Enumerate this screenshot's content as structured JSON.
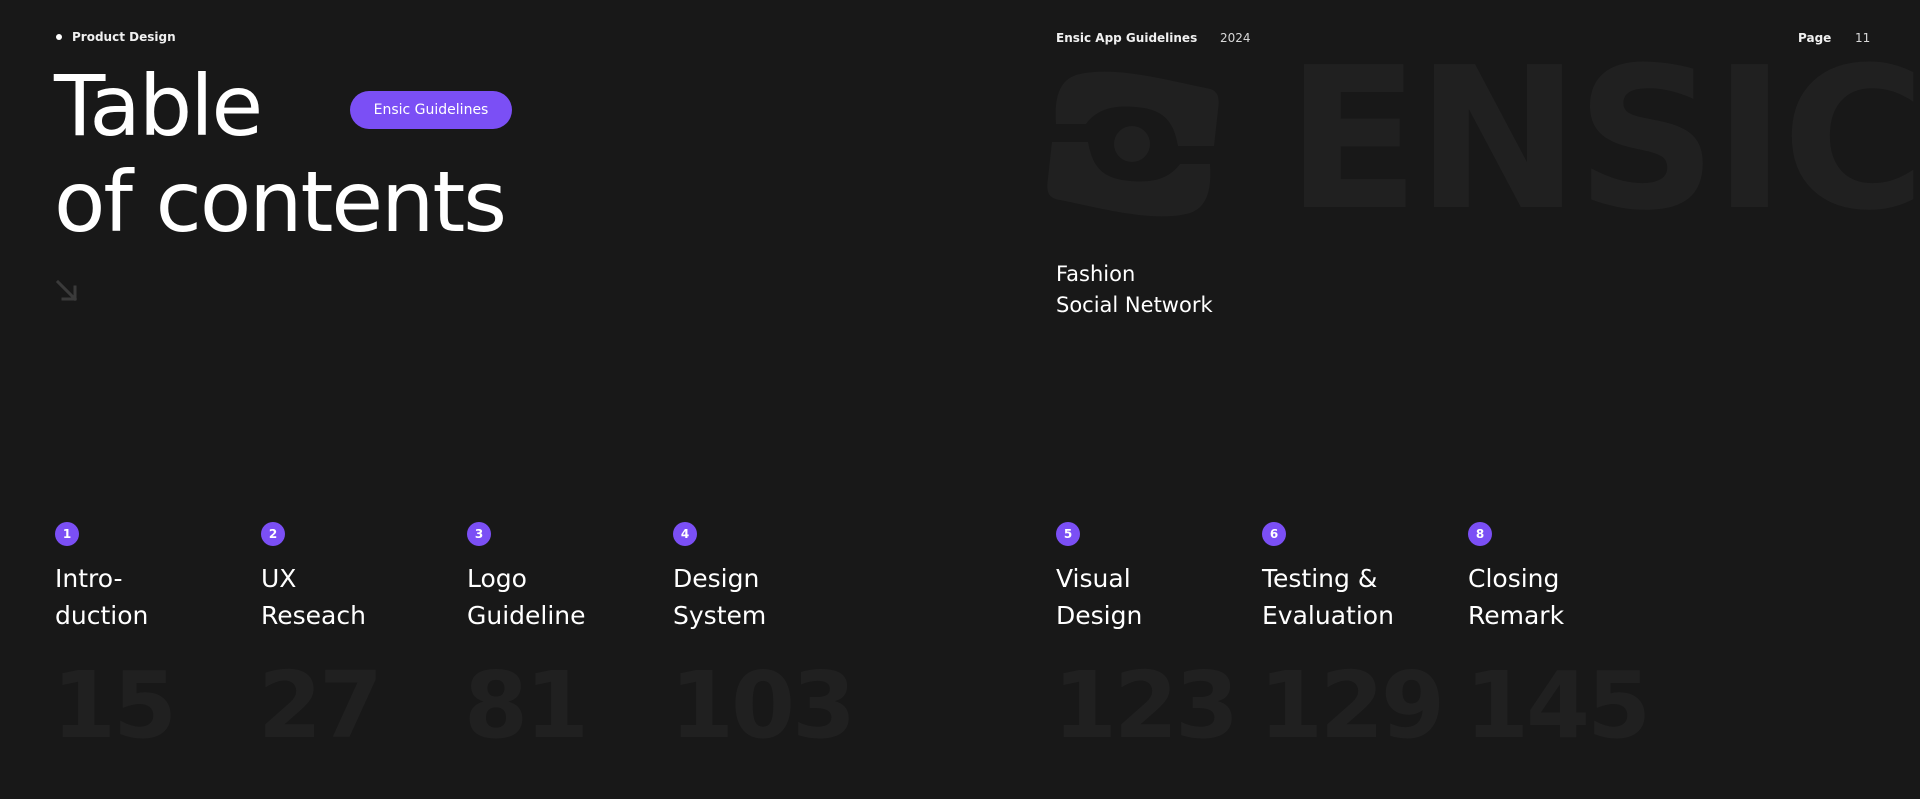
{
  "header": {
    "topic": "Product Design",
    "doc_name": "Ensic App Guidelines",
    "year": "2024",
    "page_label": "Page",
    "page_number": "11"
  },
  "title": {
    "line1": "Table",
    "line2": "of contents",
    "pill_label": "Ensic Guidelines"
  },
  "brand": {
    "wordmark": "ENSIC",
    "subtitle_line1": "Fashion",
    "subtitle_line2": "Social Network"
  },
  "icons": {
    "arrow": "arrow-down-right-icon",
    "logo": "ensic-logo-mark"
  },
  "colors": {
    "background": "#181818",
    "accent": "#7b4ff5",
    "watermark": "#202020",
    "text": "#ffffff"
  },
  "chapters": [
    {
      "number": "1",
      "title_line1": "Intro-",
      "title_line2": "duction",
      "page": "15"
    },
    {
      "number": "2",
      "title_line1": "UX",
      "title_line2": "Reseach",
      "page": "27"
    },
    {
      "number": "3",
      "title_line1": "Logo",
      "title_line2": "Guideline",
      "page": "81"
    },
    {
      "number": "4",
      "title_line1": "Design",
      "title_line2": "System",
      "page": "103"
    },
    {
      "number": "5",
      "title_line1": "Visual",
      "title_line2": "Design",
      "page": "123"
    },
    {
      "number": "6",
      "title_line1": "Testing &",
      "title_line2": "Evaluation",
      "page": "129"
    },
    {
      "number": "8",
      "title_line1": "Closing",
      "title_line2": "Remark",
      "page": "145"
    }
  ]
}
